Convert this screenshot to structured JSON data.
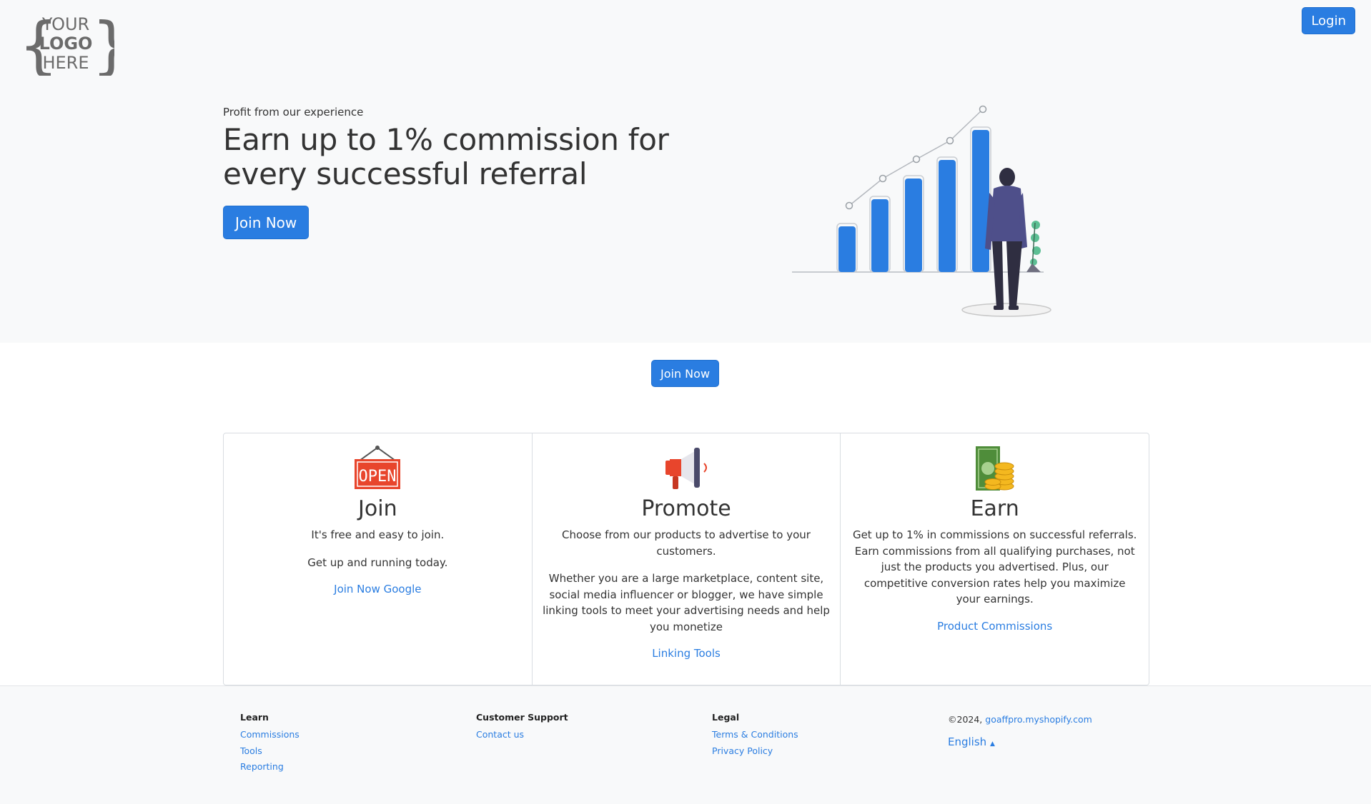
{
  "header": {
    "logo_text": [
      "YOUR",
      "LOGO",
      "HERE"
    ],
    "login_label": "Login"
  },
  "hero": {
    "eyebrow": "Profit from our experience",
    "headline_line1": "Earn up to 1% commission for",
    "headline_line2": "every successful referral",
    "join_label": "Join Now"
  },
  "mid": {
    "join_label": "Join Now"
  },
  "cards": [
    {
      "icon": "open-sign-icon",
      "title": "Join",
      "paragraphs": [
        "It's free and easy to join.",
        "Get up and running today."
      ],
      "link": "Join Now Google"
    },
    {
      "icon": "megaphone-icon",
      "title": "Promote",
      "paragraphs": [
        "Choose from our products to advertise to your customers.",
        "Whether you are a large marketplace, content site, social media influencer or blogger, we have simple linking tools to meet your advertising needs and help you monetize"
      ],
      "link": "Linking Tools"
    },
    {
      "icon": "money-coins-icon",
      "title": "Earn",
      "paragraphs": [
        "Get up to 1% in commissions on successful referrals. Earn commissions from all qualifying purchases, not just the products you advertised. Plus, our competitive conversion rates help you maximize your earnings."
      ],
      "link": "Product Commissions"
    }
  ],
  "footer": {
    "learn": {
      "heading": "Learn",
      "links": [
        "Commissions",
        "Tools",
        "Reporting"
      ]
    },
    "support": {
      "heading": "Customer Support",
      "links": [
        "Contact us"
      ]
    },
    "legal": {
      "heading": "Legal",
      "links": [
        "Terms & Conditions",
        "Privacy Policy"
      ]
    },
    "copyright_prefix": "©2024, ",
    "site_link": "goaffpro.myshopify.com",
    "language": "English"
  },
  "colors": {
    "accent": "#2a7de1",
    "hero_bg": "#f8f9fa",
    "bar_blue": "#2a7de1"
  }
}
